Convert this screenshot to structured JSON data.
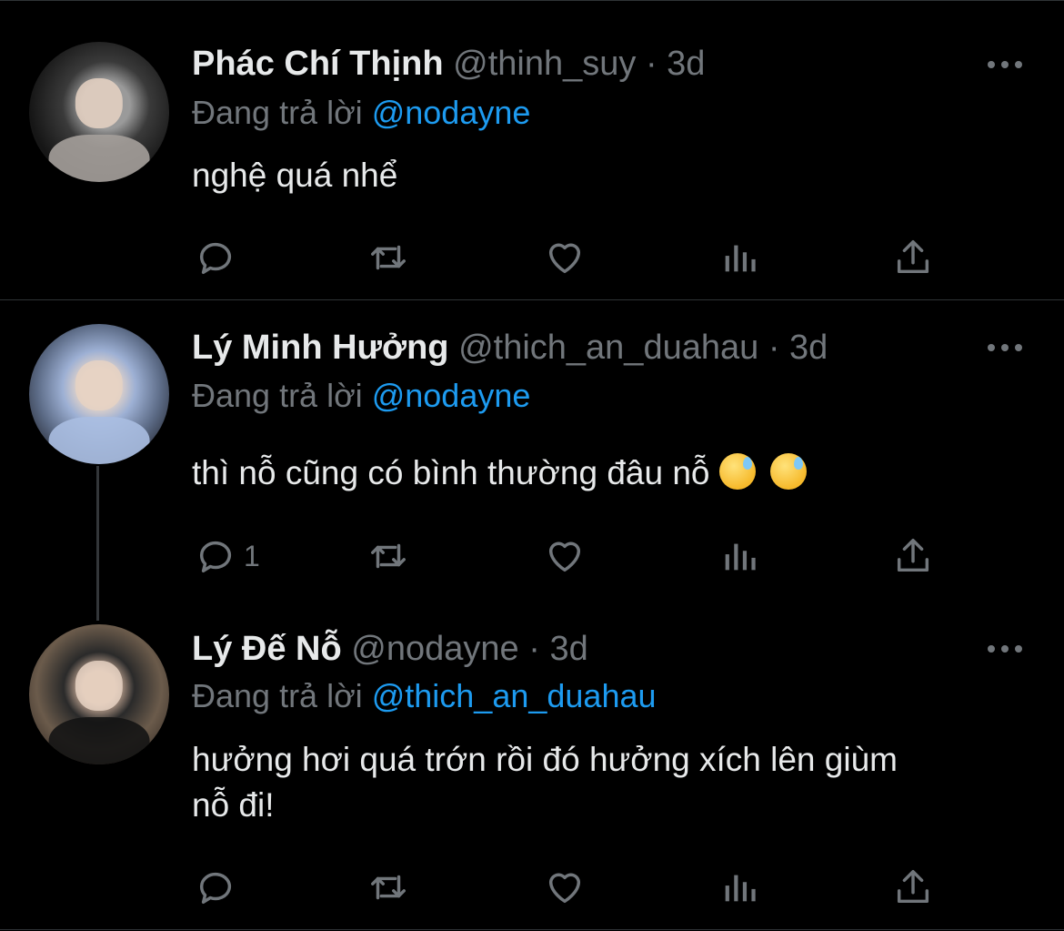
{
  "tweets": [
    {
      "name": "Phác Chí Thịnh",
      "handle": "@thinh_suy",
      "separator": "·",
      "time": "3d",
      "reply_prefix": "Đang trả lời",
      "reply_to": "@nodayne",
      "text": "nghệ quá nhể",
      "reply_count": ""
    },
    {
      "name": "Lý Minh Hưởng",
      "handle": "@thich_an_duahau",
      "separator": "·",
      "time": "3d",
      "reply_prefix": "Đang trả lời",
      "reply_to": "@nodayne",
      "text": "thì nỗ cũng có bình thường đâu nỗ",
      "emojis": [
        "sweat-smile-emoji",
        "sweat-smile-emoji"
      ],
      "reply_count": "1"
    },
    {
      "name": "Lý Đế Nỗ",
      "handle": "@nodayne",
      "separator": "·",
      "time": "3d",
      "reply_prefix": "Đang trả lời",
      "reply_to": "@thich_an_duahau",
      "text_line1": "hưởng hơi quá trớn rồi đó hưởng xích lên giùm",
      "text_line2": "nỗ đi!",
      "reply_count": ""
    }
  ],
  "icons": [
    "reply-icon",
    "retweet-icon",
    "like-icon",
    "analytics-icon",
    "share-icon",
    "more-icon"
  ],
  "colors": {
    "background": "#000000",
    "text": "#e7e9ea",
    "muted": "#71767b",
    "accent": "#1d9bf0",
    "divider": "#2f3336"
  }
}
